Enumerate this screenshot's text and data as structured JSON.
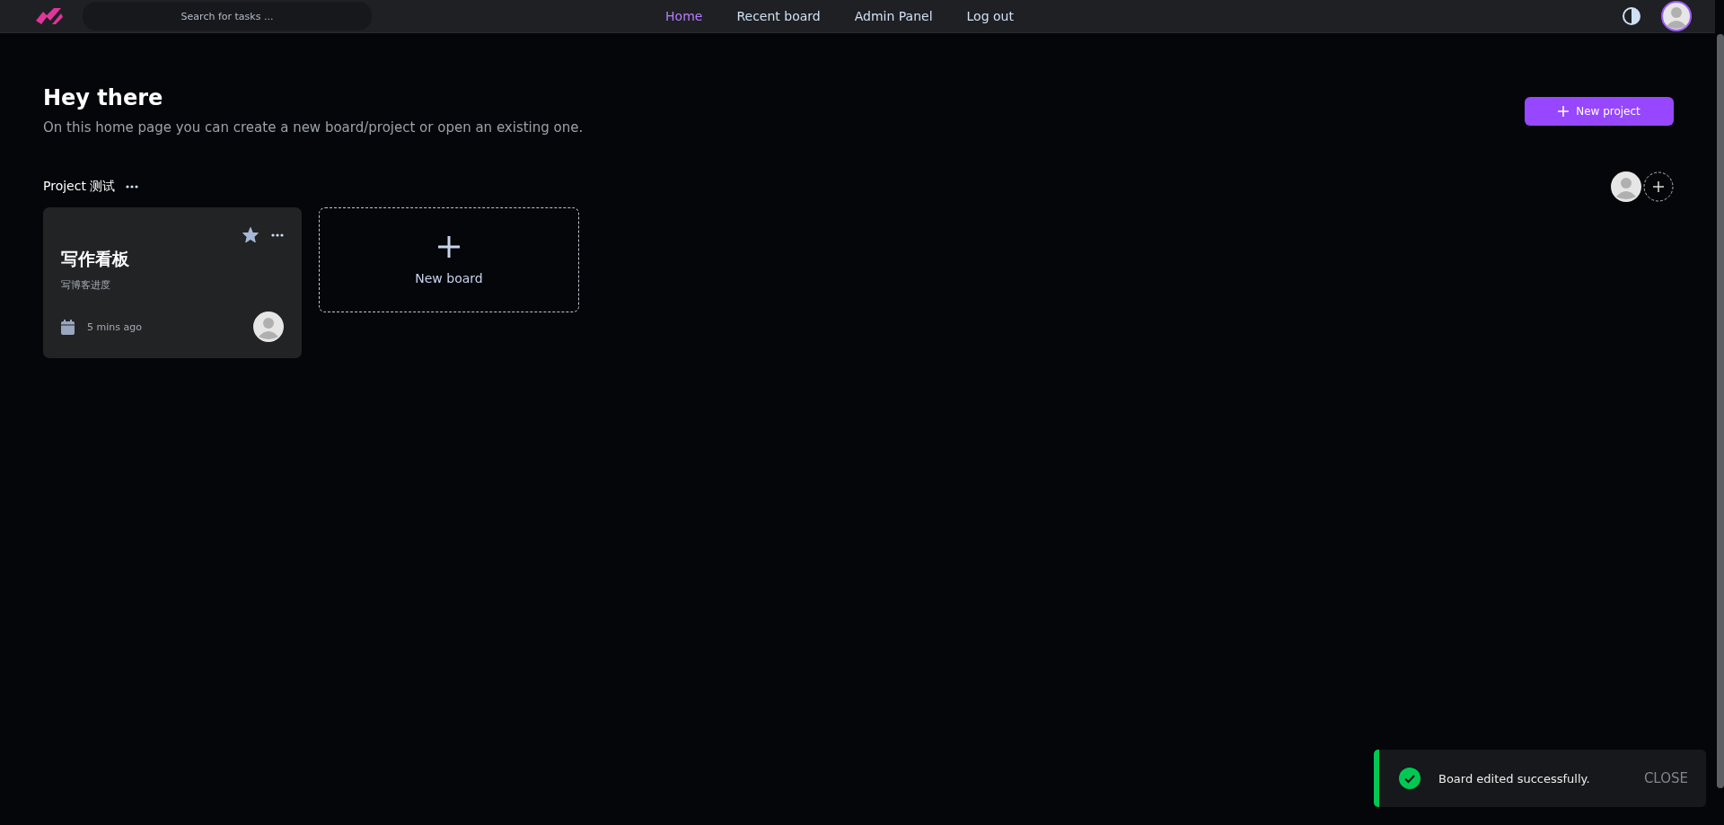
{
  "nav": {
    "search": {
      "placeholder": "Search for tasks ..."
    },
    "links": [
      {
        "label": "Home",
        "selected": true
      },
      {
        "label": "Recent board",
        "selected": false
      },
      {
        "label": "Admin Panel",
        "selected": false
      },
      {
        "label": "Log out",
        "selected": false
      }
    ]
  },
  "header": {
    "title": "Hey there",
    "subtitle": "On this home page you can create a new board/project or open an existing one.",
    "new_project_button": "New project"
  },
  "projects": [
    {
      "name": "Project 测试",
      "new_board_label": "New board",
      "boards": [
        {
          "title": "写作看板",
          "description": "写博客进度",
          "updated": "5 mins ago",
          "starred": true
        }
      ]
    }
  ],
  "toast": {
    "kind": "success",
    "message": "Board edited successfully.",
    "action": "CLOSE"
  }
}
